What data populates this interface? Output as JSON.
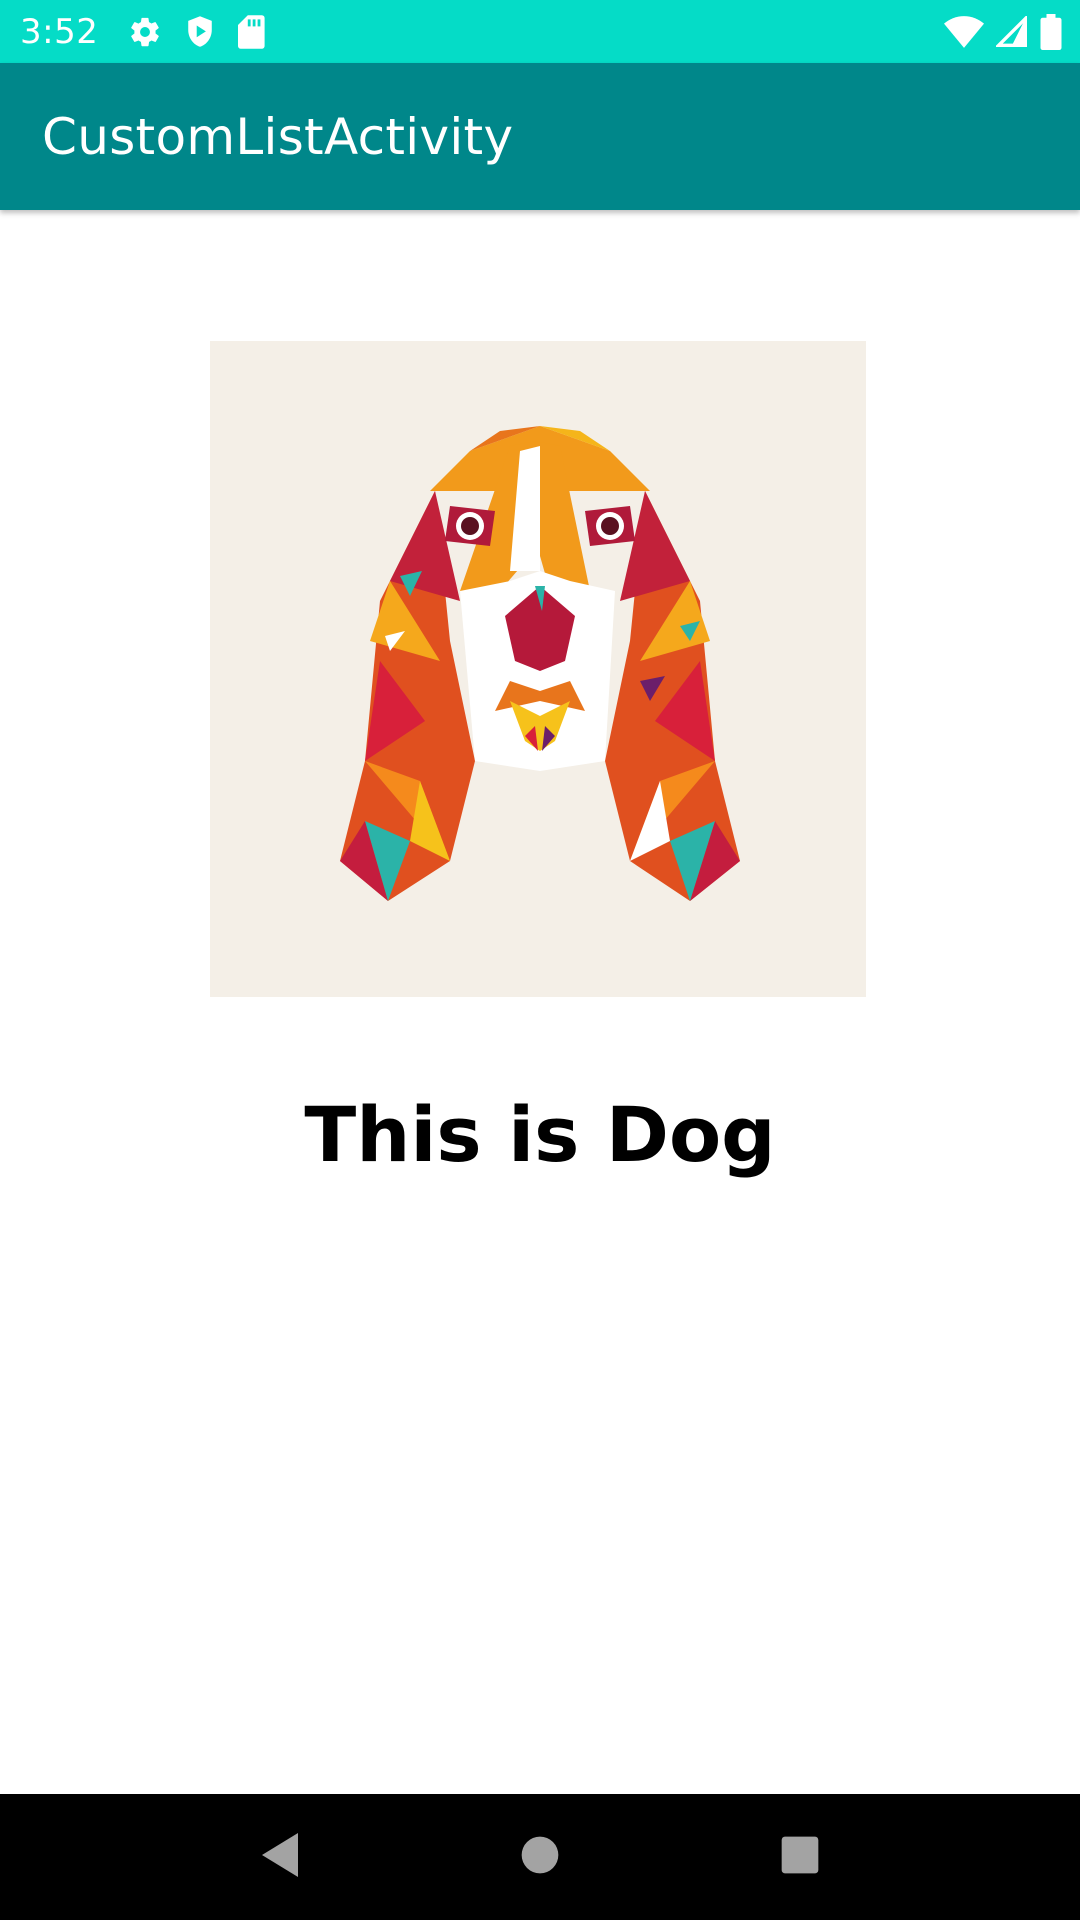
{
  "status_bar": {
    "time": "3:52",
    "bg_color": "#05dcc7",
    "left_icons": [
      "gear-icon",
      "shield-play-icon",
      "sd-card-icon"
    ],
    "right_icons": [
      "wifi-icon",
      "cellular-signal-icon",
      "battery-icon"
    ]
  },
  "app_bar": {
    "title": "CustomListActivity",
    "bg_color": "#00878a"
  },
  "content": {
    "image": {
      "subject": "dog-illustration",
      "bg_color": "#f4efe7"
    },
    "caption": "This is Dog"
  },
  "nav_bar": {
    "bg_color": "#000000",
    "buttons": [
      "back-icon",
      "home-icon",
      "recents-icon"
    ]
  }
}
